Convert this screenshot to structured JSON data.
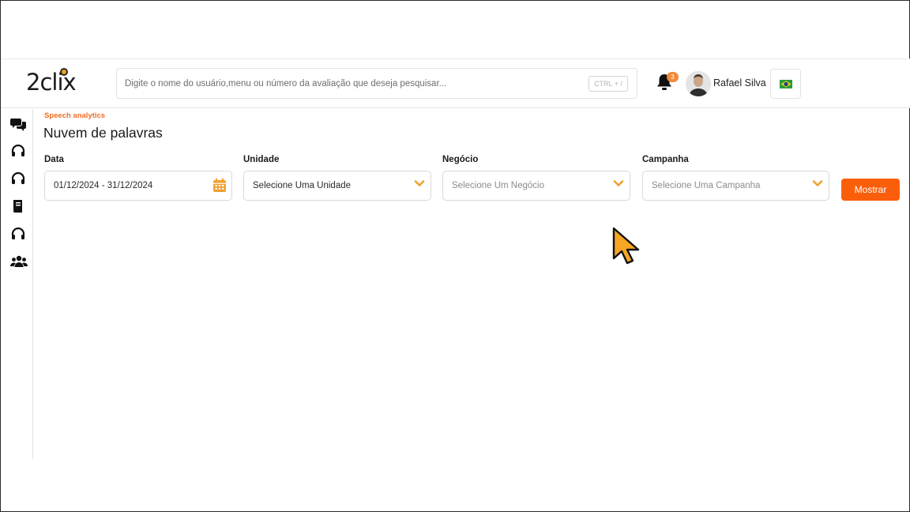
{
  "brand": {
    "logo_text": "2clix",
    "accent": "#fb5e0b"
  },
  "header": {
    "search_placeholder": "Digite o nome do usuário,menu ou número da avaliação que deseja pesquisar...",
    "search_shortcut": "CTRL + /",
    "notifications_count": "3",
    "user_name": "Rafael Silva",
    "language_flag": "brazil-flag-icon"
  },
  "sidebar": {
    "items": [
      {
        "icon": "chat-bubbles-icon"
      },
      {
        "icon": "headset-icon"
      },
      {
        "icon": "headset-icon"
      },
      {
        "icon": "book-icon"
      },
      {
        "icon": "headset-icon"
      },
      {
        "icon": "users-icon"
      }
    ]
  },
  "page": {
    "breadcrumb": "Speech analytics",
    "title": "Nuvem de palavras"
  },
  "filters": {
    "date": {
      "label": "Data",
      "value": "01/12/2024 - 31/12/2024"
    },
    "unit": {
      "label": "Unidade",
      "value": "Selecione Uma Unidade"
    },
    "business": {
      "label": "Negócio",
      "value": "Selecione Um Negócio"
    },
    "campaign": {
      "label": "Campanha",
      "value": "Selecione Uma Campanha"
    },
    "submit_label": "Mostrar"
  },
  "colors": {
    "breadcrumb": "#f26b1d",
    "chevron": "#f0a030",
    "calendar": "#f0a030",
    "badge": "#f08a3c",
    "cursor": "#f5a623"
  }
}
